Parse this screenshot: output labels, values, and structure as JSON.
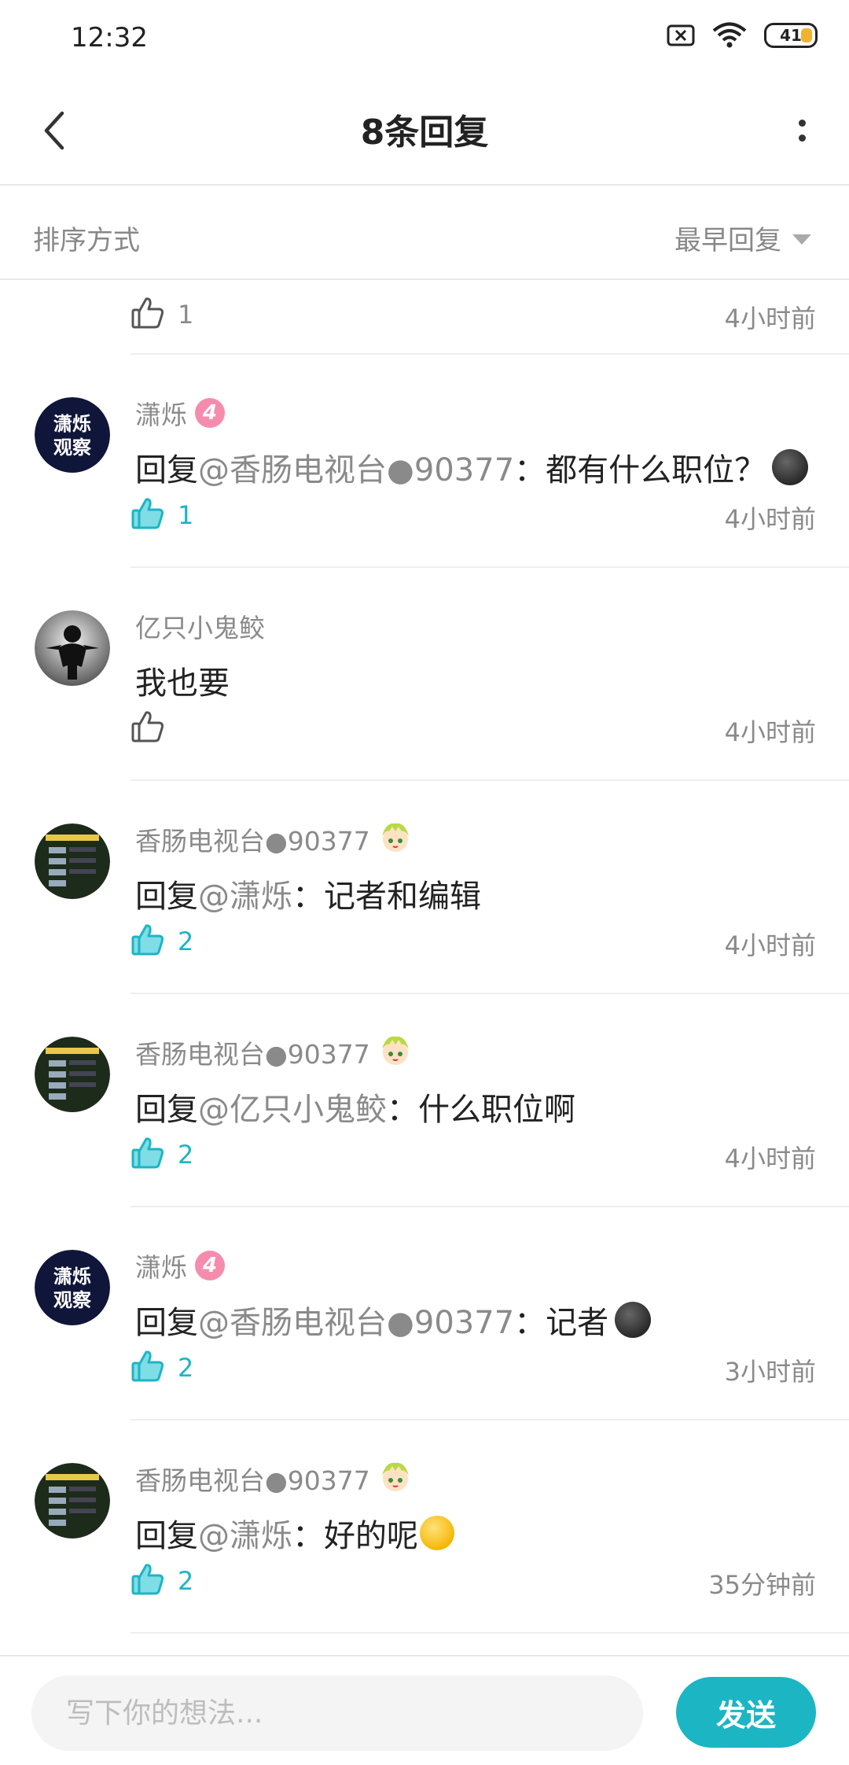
{
  "status_bar": {
    "time": "12:32",
    "battery": "41"
  },
  "header": {
    "title": "8条回复"
  },
  "sort": {
    "label": "排序方式",
    "value": "最早回复"
  },
  "partial_item": {
    "likes": "1",
    "time": "4小时前",
    "liked": false
  },
  "comments": [
    {
      "user": "潇烁",
      "level": "4",
      "badge": "level",
      "prefix": "回复",
      "mention": "@香肠电视台●90377",
      "text": "：都有什么职位？",
      "emoji": "dark",
      "likes": "1",
      "liked": true,
      "time": "4小时前",
      "avatar": "xiaoshuo"
    },
    {
      "user": "亿只小鬼鲛",
      "level": "",
      "badge": "none",
      "prefix": "",
      "mention": "",
      "text": "我也要",
      "emoji": "",
      "likes": "",
      "liked": false,
      "time": "4小时前",
      "avatar": "ninja"
    },
    {
      "user": "香肠电视台●90377",
      "level": "",
      "badge": "anime",
      "prefix": "回复",
      "mention": "@潇烁",
      "text": "：记者和编辑",
      "emoji": "",
      "likes": "2",
      "liked": true,
      "time": "4小时前",
      "avatar": "game"
    },
    {
      "user": "香肠电视台●90377",
      "level": "",
      "badge": "anime",
      "prefix": "回复",
      "mention": "@亿只小鬼鲛",
      "text": "：什么职位啊",
      "emoji": "",
      "likes": "2",
      "liked": true,
      "time": "4小时前",
      "avatar": "game"
    },
    {
      "user": "潇烁",
      "level": "4",
      "badge": "level",
      "prefix": "回复",
      "mention": "@香肠电视台●90377",
      "text": "：记者",
      "emoji": "dark",
      "likes": "2",
      "liked": true,
      "time": "3小时前",
      "avatar": "xiaoshuo"
    },
    {
      "user": "香肠电视台●90377",
      "level": "",
      "badge": "anime",
      "prefix": "回复",
      "mention": "@潇烁",
      "text": "：好的呢",
      "emoji": "laugh",
      "likes": "2",
      "liked": true,
      "time": "35分钟前",
      "avatar": "game"
    }
  ],
  "avatars": {
    "xiaoshuo": {
      "line1": "潇烁",
      "line2": "观察"
    }
  },
  "input": {
    "placeholder": "写下你的想法..."
  },
  "send_label": "发送",
  "colors": {
    "accent": "#1cb5c4",
    "level_badge": "#f58cae",
    "meta_text": "#8a8a8a"
  }
}
